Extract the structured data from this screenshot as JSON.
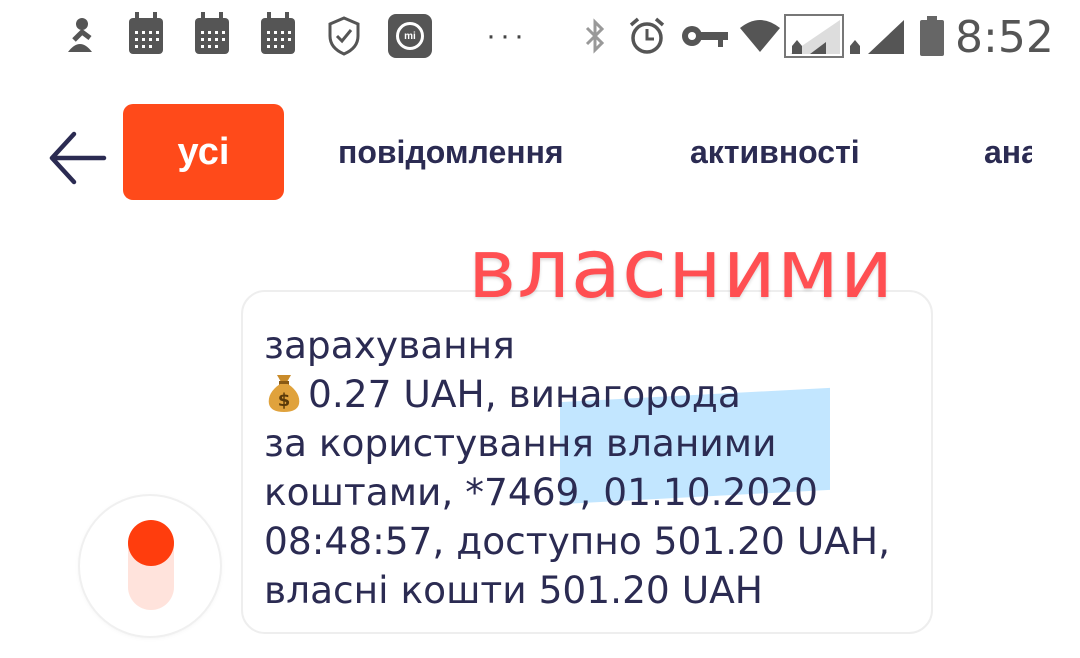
{
  "status_bar": {
    "time": "8:52",
    "icons": [
      "meditation-figure-icon",
      "calendar-icon",
      "calendar-icon",
      "calendar-icon",
      "shield-check-icon",
      "mi-app-icon",
      "more-dots-icon",
      "bluetooth-icon",
      "alarm-icon",
      "key-icon",
      "wifi-icon",
      "signal-sim1-icon",
      "signal-sim2-icon",
      "battery-icon"
    ],
    "more_dots": "···"
  },
  "tabs": [
    {
      "label": "усі",
      "active": true
    },
    {
      "label": "повідомлення",
      "active": false
    },
    {
      "label": "активності",
      "active": false
    },
    {
      "label": "ана",
      "active": false
    }
  ],
  "overlay_caption": "власними",
  "message": {
    "lines": [
      "зарахування",
      "0.27 UAH, винагорода",
      "за користування вланими",
      "коштами, *7469, 01.10.2020",
      "08:48:57, доступно 501.20 UAH,",
      "власні кошти 501.20 UAH"
    ],
    "emoji": "money-bag-icon"
  },
  "colors": {
    "accent": "#ff4a1a",
    "text": "#2b2b52",
    "overlay_text": "#ff4f52",
    "highlight": "#78c8ff"
  }
}
